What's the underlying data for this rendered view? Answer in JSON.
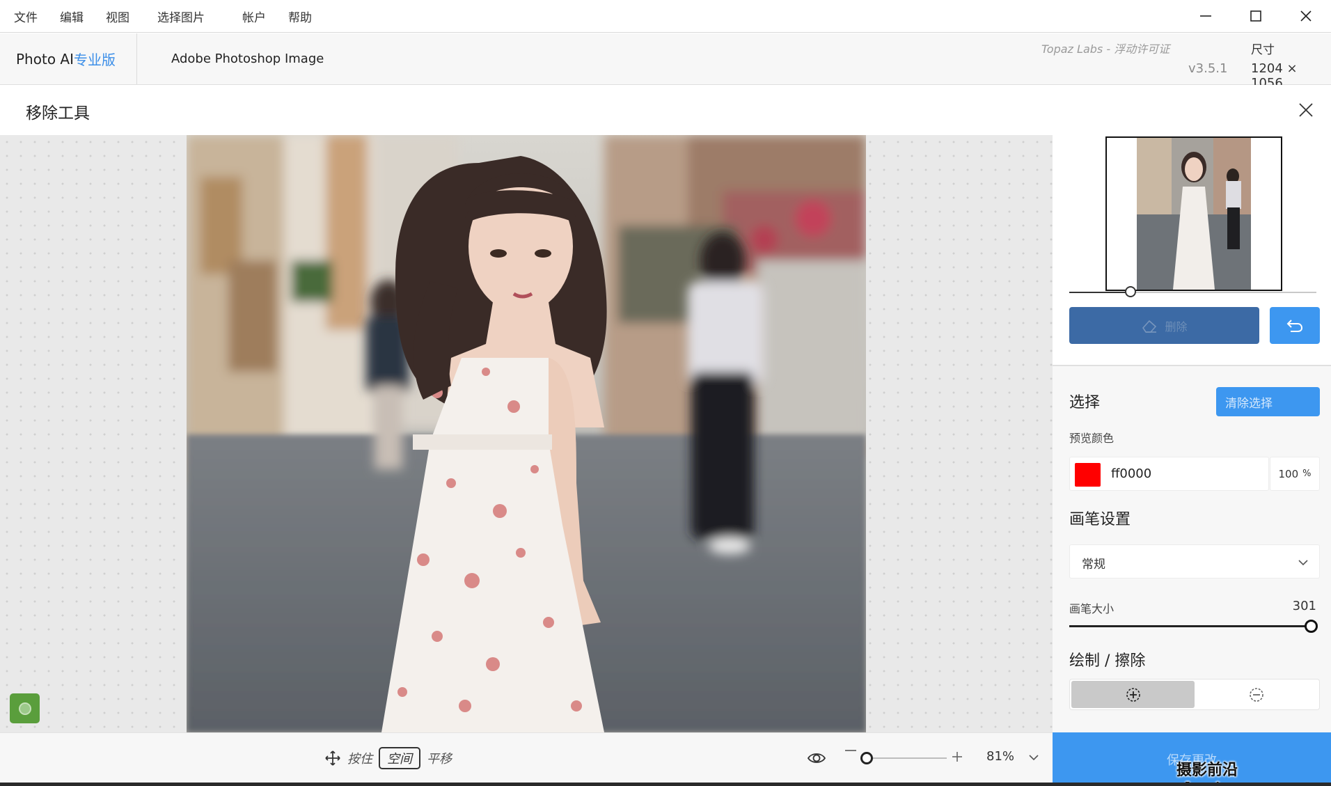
{
  "menu": {
    "items": [
      "文件",
      "编辑",
      "视图",
      "选择图片",
      "帐户",
      "帮助"
    ]
  },
  "window_controls": {
    "icons": [
      "minimize-icon",
      "maximize-icon",
      "close-icon"
    ]
  },
  "header": {
    "brand_name": "Photo AI",
    "brand_edition": "专业版",
    "document_title": "Adobe Photoshop Image",
    "license": "Topaz Labs - 浮动许可证",
    "version": "v3.5.1",
    "size_label": "尺寸",
    "size_value": "1204 × 1056"
  },
  "tool": {
    "title": "移除工具"
  },
  "bottombar": {
    "pan_hold": "按住",
    "pan_key": "空间",
    "pan_action": "平移",
    "zoom_value": "81%",
    "zoom_level": 0.81
  },
  "panel": {
    "erase_button": "删除",
    "selection_title": "选择",
    "clear_selection": "清除选择",
    "preview_color_label": "预览颜色",
    "preview_color_hex": "ff0000",
    "preview_opacity": "100",
    "preview_opacity_unit": "%",
    "brush_settings_title": "画笔设置",
    "brush_mode": "常规",
    "brush_size_label": "画笔大小",
    "brush_size_value": "301",
    "draw_erase_title": "绘制 / 擦除",
    "save_button": "保存更改"
  },
  "colors": {
    "accent": "#3d97f0",
    "erase_button": "#3c6aa5",
    "preview_color": "#ff0000",
    "brand_accent": "#3b8ee8"
  },
  "watermark": "摄影前沿 sheyingzyz.com"
}
